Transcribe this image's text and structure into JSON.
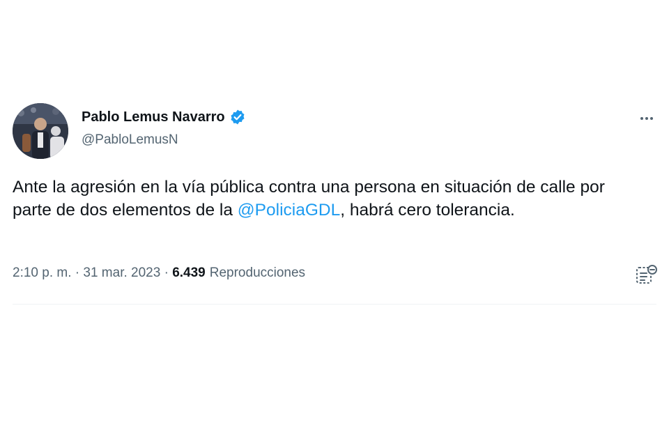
{
  "author": {
    "display_name": "Pablo Lemus Navarro",
    "handle": "@PabloLemusN"
  },
  "tweet": {
    "text_before": "Ante la agresión en la vía pública contra una persona en situación de calle por parte de dos elementos de la ",
    "mention": "@PoliciaGDL",
    "text_after": ", habrá cero tolerancia."
  },
  "meta": {
    "time": "2:10 p. m.",
    "sep1": " · ",
    "date": "31 mar. 2023",
    "sep2": " · ",
    "views_count": "6.439",
    "views_label": "Reproducciones"
  },
  "colors": {
    "accent": "#1d9bf0",
    "text": "#0f1419",
    "secondary": "#536471"
  },
  "icons": {
    "verified": "verified-badge-icon",
    "more": "more-horizontal-icon",
    "analytics": "analytics-icon"
  }
}
